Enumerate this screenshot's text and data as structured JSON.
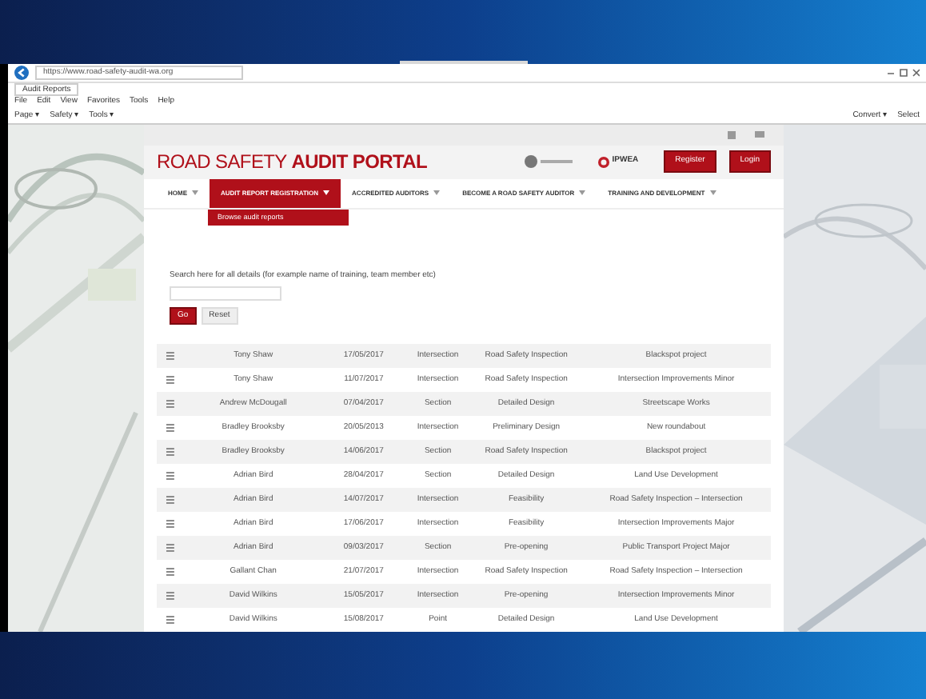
{
  "browser": {
    "address": "https://www.road-safety-audit-wa.org",
    "tab": "Audit Reports",
    "menu": [
      "File",
      "Edit",
      "View",
      "Favorites",
      "Tools",
      "Help"
    ],
    "toolbar": [
      "Page ▾",
      "Safety ▾",
      "Tools ▾"
    ],
    "right_links": [
      "Convert ▾",
      "Select"
    ]
  },
  "site": {
    "title": "ROAD SAFETY **AUDIT PORTAL**",
    "logo": "IPWEA",
    "header_buttons": [
      "Register",
      "Login"
    ],
    "nav": [
      {
        "label": "HOME",
        "selected": false
      },
      {
        "label": "AUDIT REPORT REGISTRATION",
        "selected": true
      },
      {
        "label": "ACCREDITED AUDITORS",
        "selected": false
      },
      {
        "label": "BECOME A ROAD SAFETY AUDITOR",
        "selected": false
      },
      {
        "label": "TRAINING AND DEVELOPMENT",
        "selected": false
      }
    ],
    "dropdown": [
      "Browse audit reports"
    ]
  },
  "search": {
    "label": "Search here for all details (for example name of training, team member etc)",
    "buttons": [
      {
        "label": "Go",
        "kind": "primary"
      },
      {
        "label": "Reset",
        "kind": "default"
      }
    ]
  },
  "rows": [
    [
      "Tony Shaw",
      "17/05/2017",
      "Intersection",
      "Road Safety Inspection",
      "Blackspot project"
    ],
    [
      "Tony Shaw",
      "11/07/2017",
      "Intersection",
      "Road Safety Inspection",
      "Intersection Improvements Minor"
    ],
    [
      "Andrew McDougall",
      "07/04/2017",
      "Section",
      "Detailed Design",
      "Streetscape Works"
    ],
    [
      "Bradley Brooksby",
      "20/05/2013",
      "Intersection",
      "Preliminary Design",
      "New roundabout"
    ],
    [
      "Bradley Brooksby",
      "14/06/2017",
      "Section",
      "Road Safety Inspection",
      "Blackspot project"
    ],
    [
      "Adrian Bird",
      "28/04/2017",
      "Section",
      "Detailed Design",
      "Land Use Development"
    ],
    [
      "Adrian Bird",
      "14/07/2017",
      "Intersection",
      "Feasibility",
      "Road Safety Inspection – Intersection"
    ],
    [
      "Adrian Bird",
      "17/06/2017",
      "Intersection",
      "Feasibility",
      "Intersection Improvements Major"
    ],
    [
      "Adrian Bird",
      "09/03/2017",
      "Section",
      "Pre-opening",
      "Public Transport Project Major"
    ],
    [
      "Gallant Chan",
      "21/07/2017",
      "Intersection",
      "Road Safety Inspection",
      "Road Safety Inspection – Intersection"
    ],
    [
      "David Wilkins",
      "15/05/2017",
      "Intersection",
      "Pre-opening",
      "Intersection Improvements Minor"
    ],
    [
      "David Wilkins",
      "15/08/2017",
      "Point",
      "Detailed Design",
      "Land Use Development"
    ]
  ]
}
